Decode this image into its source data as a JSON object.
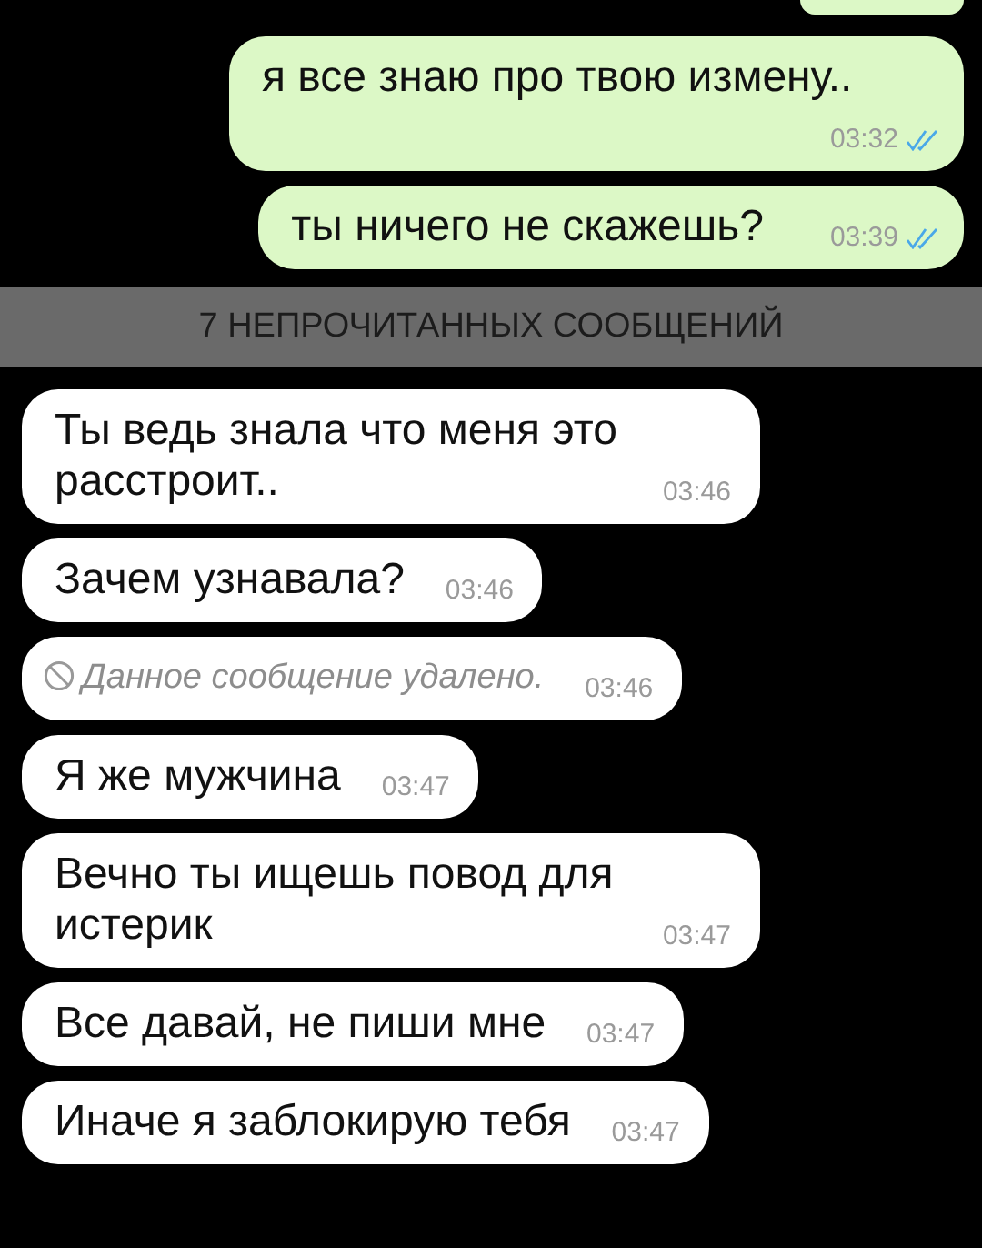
{
  "earlier_messages": [
    {
      "kind": "clipped",
      "outgoing": true
    },
    {
      "kind": "text",
      "outgoing": true,
      "text": "я все знаю про твою измену..",
      "time": "03:32",
      "read": true
    },
    {
      "kind": "text",
      "outgoing": true,
      "text": "ты ничего не скажешь?",
      "time": "03:39",
      "read": true
    }
  ],
  "unread_banner": "7 НЕПРОЧИТАННЫХ СООБЩЕНИЙ",
  "unread_messages": [
    {
      "kind": "text",
      "outgoing": false,
      "text": "Ты ведь знала что меня это расстроит..",
      "time": "03:46"
    },
    {
      "kind": "text",
      "outgoing": false,
      "text": "Зачем узнавала?",
      "time": "03:46"
    },
    {
      "kind": "deleted",
      "outgoing": false,
      "text": "Данное сообщение удалено.",
      "time": "03:46"
    },
    {
      "kind": "text",
      "outgoing": false,
      "text": "Я же мужчина",
      "time": "03:47"
    },
    {
      "kind": "text",
      "outgoing": false,
      "text": "Вечно ты ищешь повод для истерик",
      "time": "03:47"
    },
    {
      "kind": "text",
      "outgoing": false,
      "text": "Все давай, не пиши мне",
      "time": "03:47"
    },
    {
      "kind": "text",
      "outgoing": false,
      "text": "Иначе я заблокирую тебя",
      "time": "03:47"
    }
  ]
}
